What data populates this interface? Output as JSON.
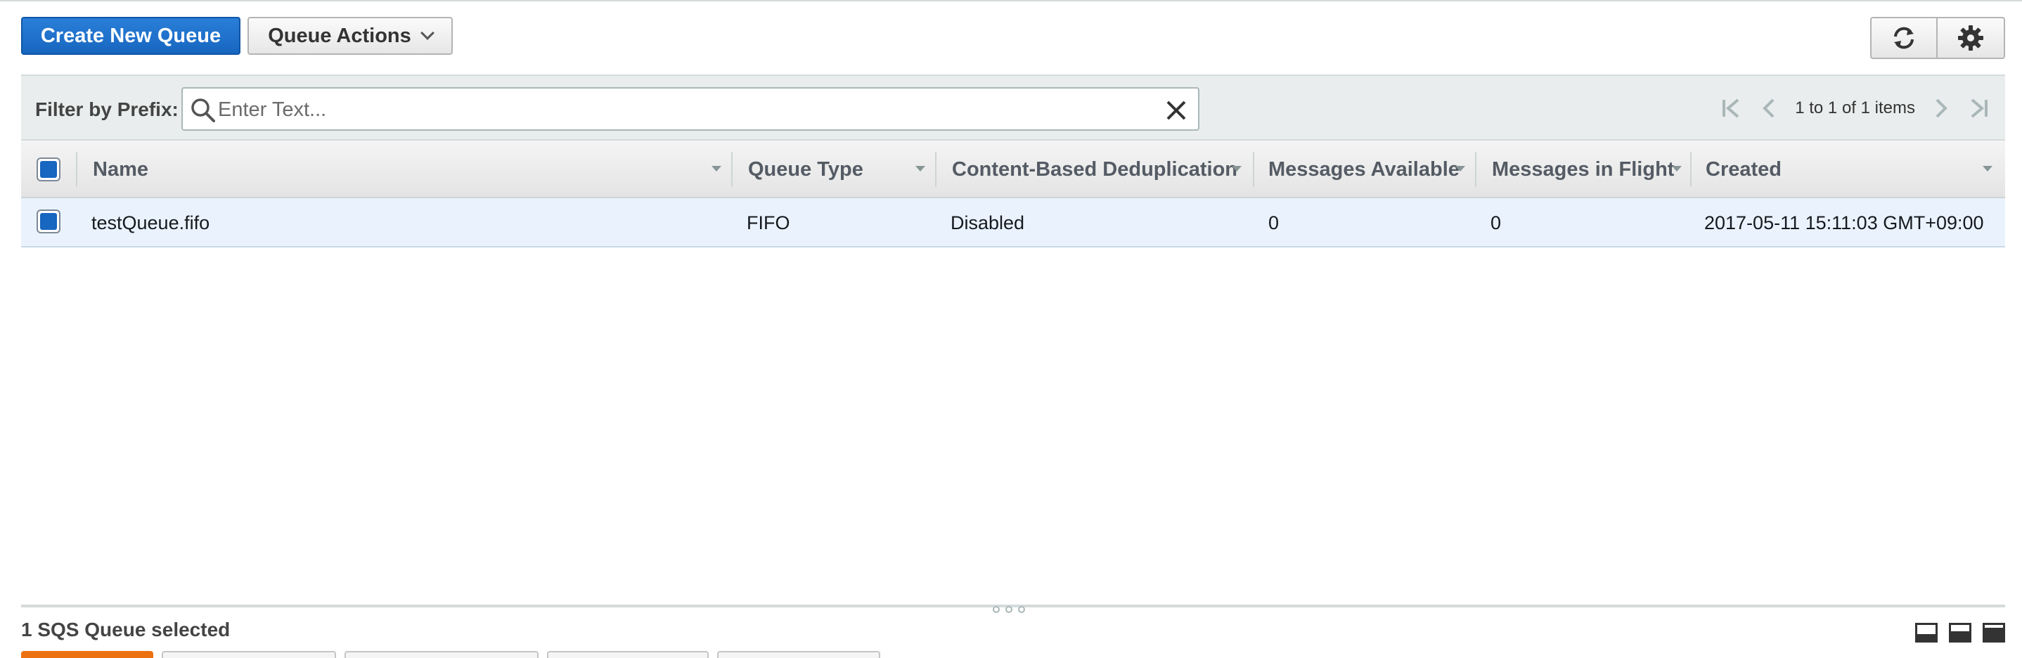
{
  "toolbar": {
    "create_label": "Create New Queue",
    "actions_label": "Queue Actions",
    "refresh_icon": "refresh-icon",
    "settings_icon": "gear-icon"
  },
  "filter": {
    "label": "Filter by Prefix:",
    "placeholder": "Enter Text...",
    "value": ""
  },
  "pagination": {
    "text": "1 to 1 of 1 items"
  },
  "table": {
    "columns": [
      "Name",
      "Queue Type",
      "Content-Based Deduplication",
      "Messages Available",
      "Messages in Flight",
      "Created"
    ],
    "rows": [
      {
        "selected": true,
        "name": "testQueue.fifo",
        "queue_type": "FIFO",
        "dedup": "Disabled",
        "messages_available": "0",
        "messages_in_flight": "0",
        "created": "2017-05-11 15:11:03 GMT+09:00"
      }
    ]
  },
  "bottom": {
    "selection_text": "1 SQS Queue selected"
  },
  "colors": {
    "primary": "#1766c0",
    "selected_row": "#eaf3fd",
    "active_tab": "#ec7211"
  }
}
